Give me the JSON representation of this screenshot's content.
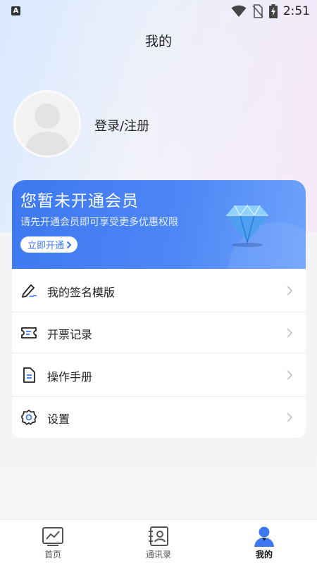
{
  "status_bar": {
    "time": "2:51",
    "app_badge": "A"
  },
  "page": {
    "title": "我的"
  },
  "profile": {
    "login_label": "登录/注册"
  },
  "vip_card": {
    "title": "您暂未开通会员",
    "subtitle": "请先开通会员即可享受更多优惠权限",
    "button_label": "立即开通",
    "accent": "#3d78f0"
  },
  "menu": {
    "items": [
      {
        "label": "我的签名模版",
        "icon": "signature-pen-icon"
      },
      {
        "label": "开票记录",
        "icon": "ticket-icon"
      },
      {
        "label": "操作手册",
        "icon": "document-icon"
      },
      {
        "label": "设置",
        "icon": "gear-icon"
      }
    ]
  },
  "bottom_nav": {
    "tabs": [
      {
        "label": "首页",
        "icon": "chart-icon",
        "active": false
      },
      {
        "label": "通讯录",
        "icon": "contacts-icon",
        "active": false
      },
      {
        "label": "我的",
        "icon": "person-icon",
        "active": true
      }
    ]
  }
}
